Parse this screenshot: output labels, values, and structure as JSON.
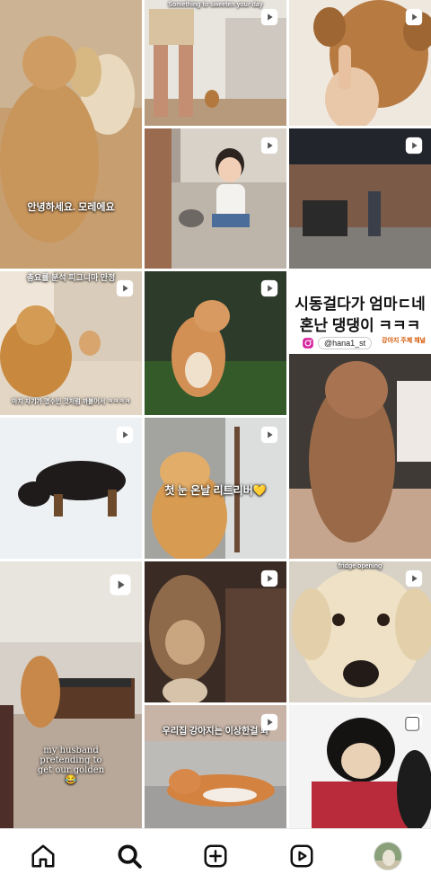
{
  "app": "Instagram Explore",
  "tiles": [
    {
      "caption": "안녕하세요. 모레에요",
      "reel": true
    },
    {
      "caption": "Something to sweeten your day",
      "reel": true
    },
    {
      "caption": "",
      "reel": true
    },
    {
      "caption": "",
      "reel": true
    },
    {
      "caption": "",
      "reel": true
    },
    {
      "top_caption": "총요를 분석 피그니마 만정",
      "caption": "마치 자기가 명수인 것처럼 까불어서 ㅋㅋㅋㅋ",
      "reel": true
    },
    {
      "caption": "",
      "reel": true
    },
    {
      "headline_line1": "시동걸다가 엄마ㄷ네",
      "headline_line2": "혼난 댕댕이 ㅋㅋㅋ",
      "handle": "@hana1_st",
      "brand": "강아지 주제 채널",
      "reel": false
    },
    {
      "caption": "",
      "reel": true
    },
    {
      "caption": "첫 눈 온날 리트리버💛",
      "reel": true
    },
    {
      "caption": "my husband pretending to get our golden 😂",
      "reel": true
    },
    {
      "caption": "",
      "reel": true
    },
    {
      "top_caption": "fridge opening",
      "caption": "",
      "reel": true
    },
    {
      "caption": "우리집 강아지는 이상한걸 봐",
      "reel": true
    },
    {
      "caption": "",
      "reel": false
    }
  ],
  "nav": {
    "home": "home-icon",
    "search": "search-icon",
    "create": "create-icon",
    "reels": "reels-icon",
    "profile": "avatar"
  }
}
